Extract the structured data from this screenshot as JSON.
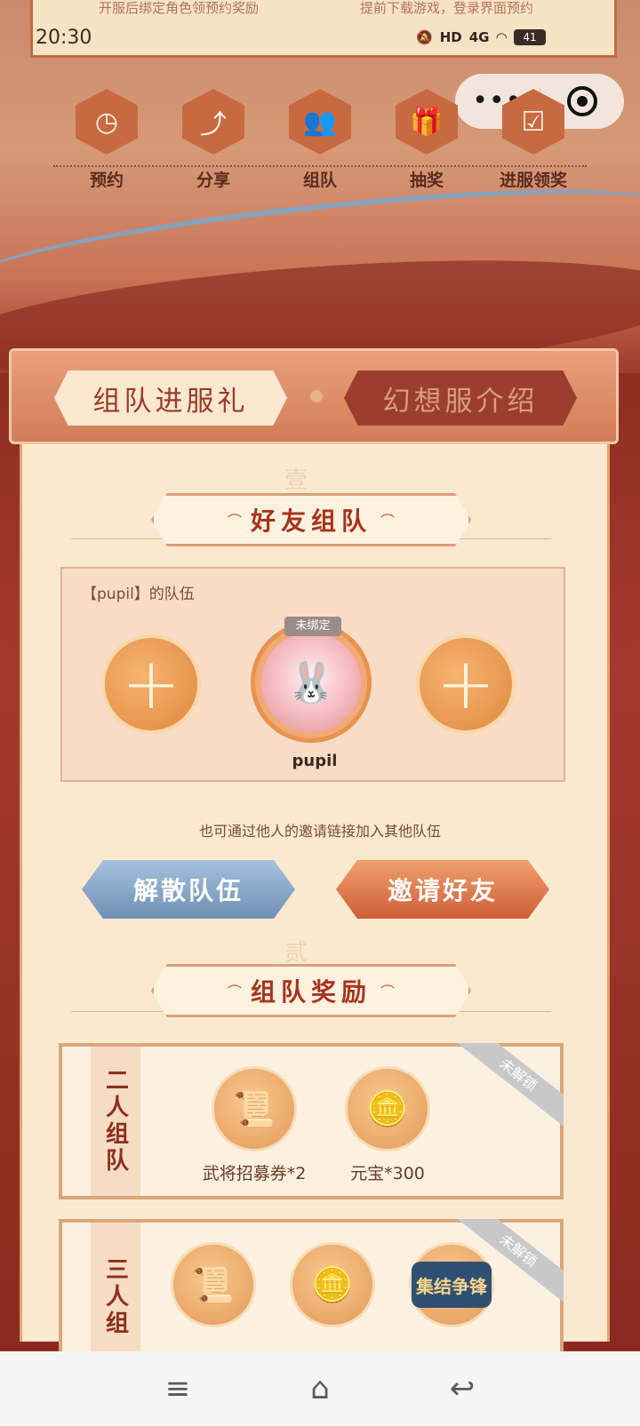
{
  "status_bar": {
    "time": "20:30",
    "network": "4G",
    "hd": "HD",
    "battery": "41"
  },
  "top_banner": {
    "left_hint": "开服后绑定角色领预约奖励",
    "right_hint": "提前下载游戏，登录界面预约"
  },
  "capsule": {
    "more_label": "•••",
    "close_icon": "target-icon"
  },
  "nav": [
    {
      "label": "预约",
      "icon": "clock-icon"
    },
    {
      "label": "分享",
      "icon": "share-icon"
    },
    {
      "label": "组队",
      "icon": "team-icon"
    },
    {
      "label": "抽奖",
      "icon": "gift-icon"
    },
    {
      "label": "进服领奖",
      "icon": "calendar-check-icon"
    }
  ],
  "tabs": {
    "active": "组队进服礼",
    "inactive": "幻想服介绍"
  },
  "section1": {
    "marker": "壹",
    "title": "好友组队"
  },
  "team": {
    "name": "【pupil】的队伍",
    "member_name": "pupil",
    "badge": "未绑定",
    "plus": "+"
  },
  "invite_hint": "也可通过他人的邀请链接加入其他队伍",
  "buttons": {
    "disband": "解散队伍",
    "invite": "邀请好友"
  },
  "section2": {
    "marker": "贰",
    "title": "组队奖励"
  },
  "rewards": [
    {
      "label": "二人组队",
      "status": "未解锁",
      "items": [
        {
          "name": "武将招募券*2",
          "icon": "scroll-icon"
        },
        {
          "name": "元宝*300",
          "icon": "ingot-icon"
        }
      ]
    },
    {
      "label": "三人组",
      "status": "未解锁",
      "items": [
        {
          "name": "",
          "icon": "scroll-icon"
        },
        {
          "name": "",
          "icon": "ingot-icon"
        },
        {
          "name": "集结争锋",
          "icon": "badge-icon"
        }
      ]
    }
  ]
}
